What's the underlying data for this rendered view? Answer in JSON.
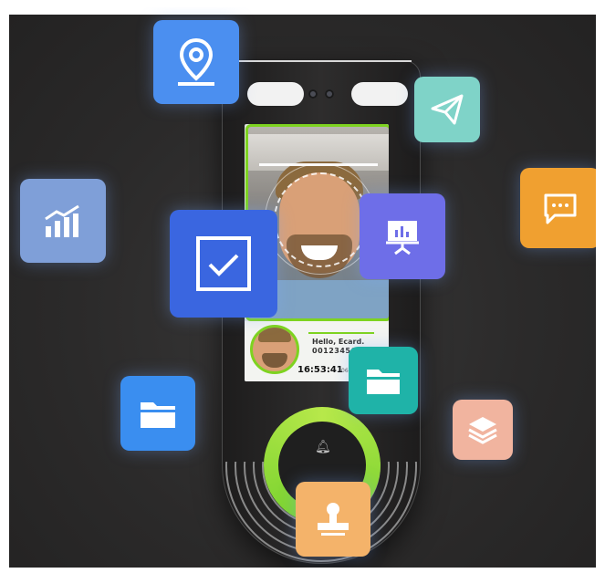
{
  "screen": {
    "greeting": "Hello, Ecard.",
    "id_number": "0012345678",
    "clock": "16:53:41",
    "clock_suffix": "06"
  },
  "icons": [
    {
      "name": "location-pin-icon",
      "color": "#4b8ff0"
    },
    {
      "name": "send-icon",
      "color": "#7fd3c8"
    },
    {
      "name": "bar-chart-icon",
      "color": "#7f9fd8"
    },
    {
      "name": "checkbox-icon",
      "color": "#3a66e0"
    },
    {
      "name": "presentation-icon",
      "color": "#6e6ee8"
    },
    {
      "name": "chat-icon",
      "color": "#f0a030"
    },
    {
      "name": "folder-icon",
      "color": "#3a8ef0"
    },
    {
      "name": "folder-icon",
      "color": "#1fb3a8"
    },
    {
      "name": "layers-icon",
      "color": "#f1b49f"
    },
    {
      "name": "stamp-icon",
      "color": "#f4b36a"
    },
    {
      "name": "bell-icon",
      "color": "#bbbbbb"
    }
  ],
  "colors": {
    "background": "#2c2b2b",
    "accent_green": "#7ed320"
  }
}
